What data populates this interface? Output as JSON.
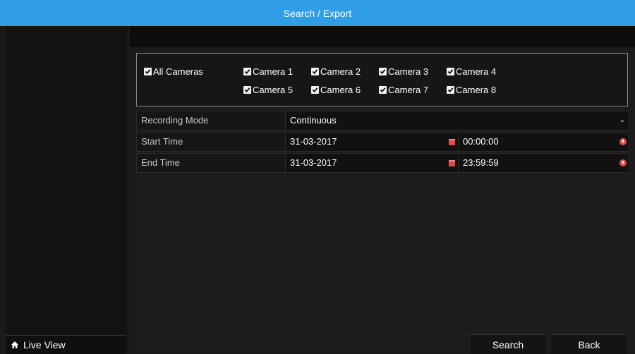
{
  "window": {
    "title": "Search / Export"
  },
  "cameras": {
    "all_label": "All Cameras",
    "items": [
      {
        "label": "Camera 1",
        "checked": true
      },
      {
        "label": "Camera 2",
        "checked": true
      },
      {
        "label": "Camera 3",
        "checked": true
      },
      {
        "label": "Camera 4",
        "checked": true
      },
      {
        "label": "Camera 5",
        "checked": true
      },
      {
        "label": "Camera 6",
        "checked": true
      },
      {
        "label": "Camera 7",
        "checked": true
      },
      {
        "label": "Camera 8",
        "checked": true
      }
    ]
  },
  "form": {
    "recording_mode": {
      "label": "Recording Mode",
      "value": "Continuous"
    },
    "start_time": {
      "label": "Start Time",
      "date": "31-03-2017",
      "time": "00:00:00"
    },
    "end_time": {
      "label": "End Time",
      "date": "31-03-2017",
      "time": "23:59:59"
    }
  },
  "footer": {
    "live_view_label": "Live View",
    "search_label": "Search",
    "back_label": "Back"
  },
  "colors": {
    "accent": "#2f9ee6",
    "icon_red": "#e04a4a"
  },
  "icons": [
    "checkbox-icon",
    "calendar-icon",
    "clock-icon",
    "home-icon",
    "chevron-down-icon"
  ]
}
